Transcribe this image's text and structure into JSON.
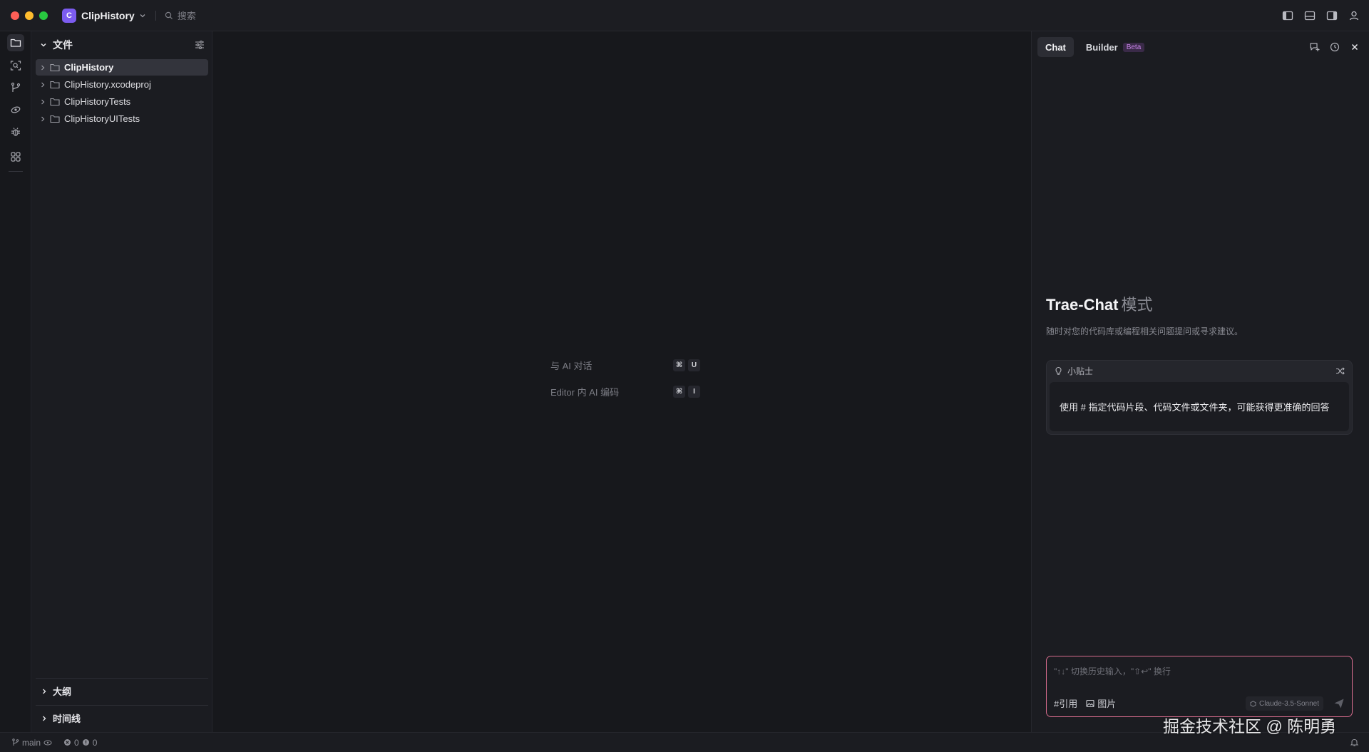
{
  "titlebar": {
    "project_initial": "C",
    "project_name": "ClipHistory",
    "search_placeholder": "搜索"
  },
  "explorer": {
    "title": "文件",
    "items": [
      {
        "label": "ClipHistory",
        "selected": true
      },
      {
        "label": "ClipHistory.xcodeproj",
        "selected": false
      },
      {
        "label": "ClipHistoryTests",
        "selected": false
      },
      {
        "label": "ClipHistoryUITests",
        "selected": false
      }
    ],
    "sections": {
      "outline": "大纲",
      "timeline": "时间线"
    }
  },
  "editor": {
    "hints": [
      {
        "label": "与 AI 对话",
        "key1": "⌘",
        "key2": "U"
      },
      {
        "label": "Editor 内 AI 编码",
        "key1": "⌘",
        "key2": "I"
      }
    ]
  },
  "chat": {
    "tabs": {
      "chat": "Chat",
      "builder": "Builder",
      "beta": "Beta"
    },
    "mode_title": "Trae-Chat",
    "mode_subtitle": "模式",
    "mode_description": "随时对您的代码库或编程相关问题提问或寻求建议。",
    "tip_title": "小贴士",
    "tip_text": "使用 # 指定代码片段、代码文件或文件夹，可能获得更准确的回答",
    "input_placeholder": "\"↑↓\" 切换历史输入，\"⇧↩\" 换行",
    "tool_reference": "#引用",
    "tool_image": "图片",
    "model": "Claude-3.5-Sonnet"
  },
  "statusbar": {
    "branch": "main",
    "errors": "0",
    "warnings": "0"
  },
  "watermark": "掘金技术社区 @ 陈明勇",
  "colors": {
    "accent_purple": "#7c5cf0",
    "input_border": "#d56b8c",
    "background": "#17181c"
  }
}
